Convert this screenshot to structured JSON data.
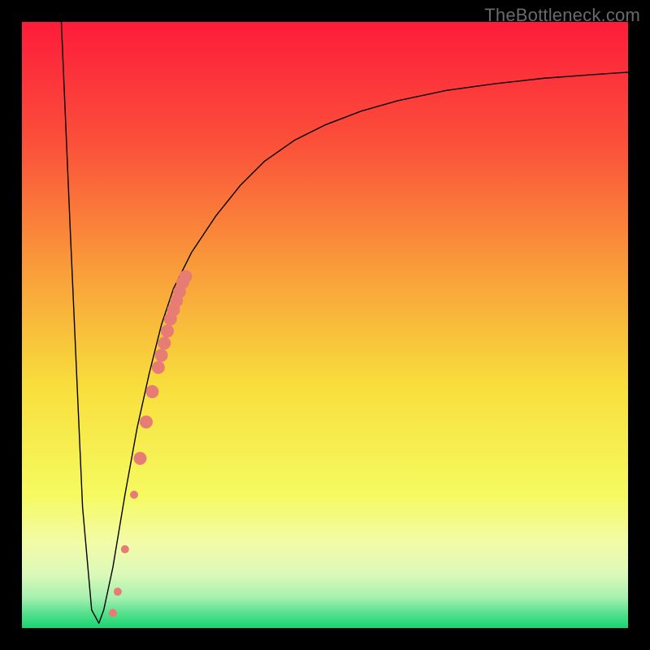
{
  "watermark": "TheBottleneck.com",
  "chart_data": {
    "type": "line",
    "title": "",
    "xlabel": "",
    "ylabel": "",
    "xlim": [
      0,
      100
    ],
    "ylim": [
      0,
      100
    ],
    "grid": false,
    "legend": false,
    "series": [
      {
        "name": "curve",
        "x": [
          6.5,
          8,
          10,
          11.5,
          12.7,
          13.5,
          15,
          17,
          19,
          21,
          23,
          25,
          28,
          32,
          36,
          40,
          45,
          50,
          56,
          62,
          70,
          78,
          86,
          94,
          100
        ],
        "y": [
          100,
          65,
          20,
          3,
          0.8,
          3,
          10,
          22,
          33,
          42,
          50,
          56,
          62,
          68,
          73,
          77,
          80.5,
          83,
          85.3,
          87,
          88.7,
          89.8,
          90.7,
          91.3,
          91.7
        ],
        "stroke": "#000000",
        "stroke_width": 1.4
      }
    ],
    "markers": {
      "name": "dots",
      "x": [
        15.0,
        15.8,
        17.0,
        18.5,
        19.5,
        20.5,
        21.5,
        22.5,
        23.0,
        23.5,
        24.0,
        24.5,
        25.0,
        25.5,
        26.0,
        26.5,
        27.0
      ],
      "y": [
        2.5,
        6.0,
        13.0,
        22.0,
        28.0,
        34.0,
        39.0,
        43.0,
        45.0,
        47.0,
        49.0,
        51.0,
        52.5,
        54.0,
        55.5,
        57.0,
        58.0
      ],
      "color": "#e77c74",
      "radius_large": 8,
      "radius_small": 5
    },
    "background_gradient": {
      "type": "vertical",
      "stops": [
        {
          "offset": 0.0,
          "color": "#fd1c3a"
        },
        {
          "offset": 0.2,
          "color": "#fb503a"
        },
        {
          "offset": 0.4,
          "color": "#f99a3a"
        },
        {
          "offset": 0.6,
          "color": "#f8de3c"
        },
        {
          "offset": 0.78,
          "color": "#f6fa60"
        },
        {
          "offset": 0.86,
          "color": "#f2fba8"
        },
        {
          "offset": 0.91,
          "color": "#dcf9b8"
        },
        {
          "offset": 0.95,
          "color": "#a6f0b0"
        },
        {
          "offset": 0.975,
          "color": "#57e18f"
        },
        {
          "offset": 1.0,
          "color": "#17d470"
        }
      ]
    }
  }
}
